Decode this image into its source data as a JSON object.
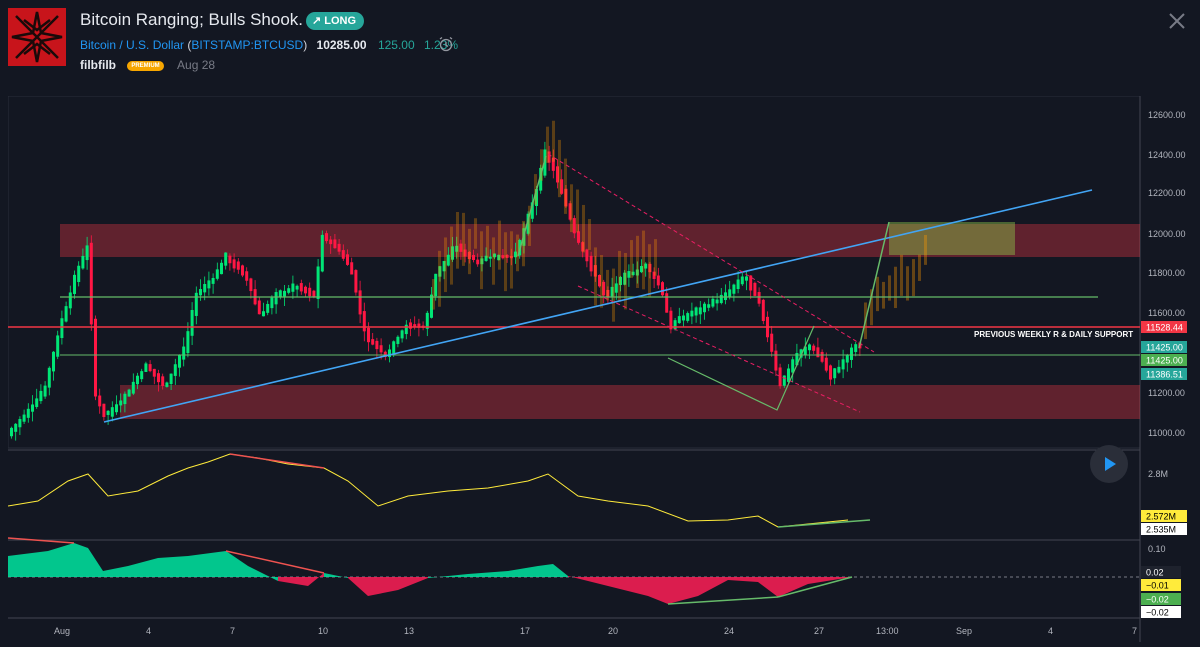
{
  "header": {
    "title": "Bitcoin Ranging; Bulls Shook.",
    "badge": "LONG",
    "symbol_name": "Bitcoin / U.S. Dollar",
    "exchange": "BITSTAMP:BTCUSD",
    "paren_open": "(",
    "paren_close": ")",
    "price": "10285.00",
    "change": "125.00",
    "change_pct": "1.23%",
    "author": "filbfilb",
    "author_badge": "PREMIUM",
    "date": "Aug 28",
    "logo_icon": "star-logo-icon",
    "alarm_icon": "alarm-clock-icon",
    "close_icon": "close-icon"
  },
  "colors": {
    "background": "#131722",
    "up": "#00e676",
    "down": "#ff1744",
    "accent": "#2196f3",
    "zone": "#8b2e3c",
    "support_line": "#f23645",
    "green_line": "#66bb6a"
  },
  "price_axis": {
    "ticks": [
      "12600.00",
      "12400.00",
      "12200.00",
      "12000.00",
      "11800.00",
      "11600.00",
      "11200.00",
      "11000.00"
    ],
    "labels": [
      {
        "text": "11528.44",
        "bg": "#f23645",
        "fg": "#ffffff"
      },
      {
        "text": "11425.00",
        "bg": "#26a69a",
        "fg": "#ffffff"
      },
      {
        "text": "11425.00",
        "bg": "#4caf50",
        "fg": "#ffffff"
      },
      {
        "text": "11386.51",
        "bg": "#26a69a",
        "fg": "#ffffff"
      }
    ]
  },
  "annotation": "PREVIOUS WEEKLY R & DAILY SUPPORT",
  "volume_axis": {
    "tick": "2.8M",
    "labels": [
      {
        "text": "2.572M",
        "bg": "#ffeb3b",
        "fg": "#000000"
      },
      {
        "text": "2.535M",
        "bg": "#ffffff",
        "fg": "#000000"
      }
    ]
  },
  "osc_axis": {
    "tick": "0.10",
    "labels": [
      {
        "text": "0.02",
        "bg": "#1e222d",
        "fg": "#ffffff"
      },
      {
        "text": "−0.01",
        "bg": "#ffeb3b",
        "fg": "#000000"
      },
      {
        "text": "−0.02",
        "bg": "#4caf50",
        "fg": "#ffffff"
      },
      {
        "text": "−0.02",
        "bg": "#ffffff",
        "fg": "#000000"
      }
    ]
  },
  "time_axis": [
    "Aug",
    "4",
    "7",
    "10",
    "13",
    "17",
    "20",
    "24",
    "27",
    "13:00",
    "Sep",
    "4",
    "7"
  ]
}
